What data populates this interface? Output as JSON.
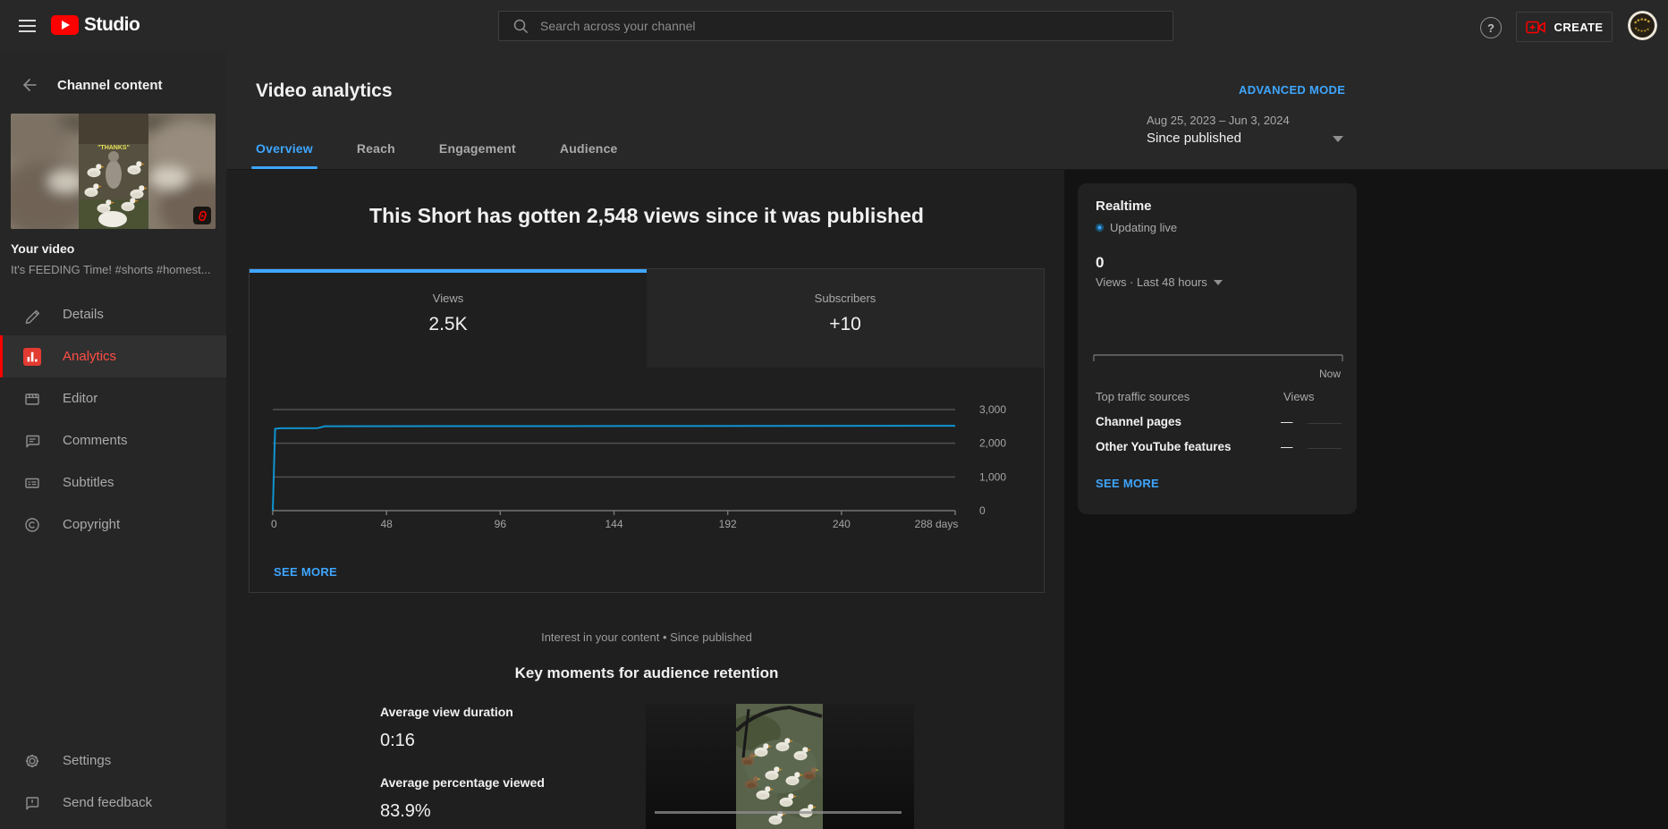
{
  "topbar": {
    "product_name": "Studio",
    "search_placeholder": "Search across your channel",
    "help_glyph": "?",
    "create_label": "CREATE"
  },
  "sidebar": {
    "header": "Channel content",
    "video_label": "Your video",
    "video_title": "It's FEEDING Time! #shorts #homest...",
    "items": [
      {
        "label": "Details",
        "icon": "pencil-icon",
        "active": false
      },
      {
        "label": "Analytics",
        "icon": "bar-chart-icon",
        "active": true
      },
      {
        "label": "Editor",
        "icon": "clapperboard-icon",
        "active": false
      },
      {
        "label": "Comments",
        "icon": "comment-icon",
        "active": false
      },
      {
        "label": "Subtitles",
        "icon": "subtitles-icon",
        "active": false
      },
      {
        "label": "Copyright",
        "icon": "copyright-icon",
        "active": false
      }
    ],
    "footer_items": [
      {
        "label": "Settings",
        "icon": "gear-icon"
      },
      {
        "label": "Send feedback",
        "icon": "feedback-icon"
      }
    ]
  },
  "header": {
    "title": "Video analytics",
    "tabs": [
      {
        "label": "Overview",
        "active": true
      },
      {
        "label": "Reach",
        "active": false
      },
      {
        "label": "Engagement",
        "active": false
      },
      {
        "label": "Audience",
        "active": false
      }
    ],
    "advanced_mode": "ADVANCED MODE",
    "date_range": "Aug 25, 2023 – Jun 3, 2024",
    "date_mode": "Since published"
  },
  "overview": {
    "headline": "This Short has gotten 2,548 views since it was published",
    "metric_tabs": [
      {
        "label": "Views",
        "value": "2.5K",
        "active": true
      },
      {
        "label": "Subscribers",
        "value": "+10",
        "active": false
      }
    ],
    "see_more": "SEE MORE"
  },
  "chart_data": [
    {
      "id": "views-over-time",
      "type": "line",
      "title": "Views since published",
      "xlabel": "days",
      "x_range": [
        0,
        288
      ],
      "x_ticks": [
        "0",
        "48",
        "96",
        "144",
        "192",
        "240",
        "288 days"
      ],
      "ylim": [
        0,
        3000
      ],
      "y_ticks": [
        "0",
        "1,000",
        "2,000",
        "3,000"
      ],
      "grid": true,
      "legend": "none",
      "line_color": "#0f94cf",
      "grid_color": "#505050",
      "axis_color": "#757575",
      "series": [
        {
          "name": "Views",
          "points": [
            [
              0,
              0
            ],
            [
              1,
              2430
            ],
            [
              3,
              2445
            ],
            [
              19,
              2450
            ],
            [
              22,
              2505
            ],
            [
              150,
              2512
            ],
            [
              288,
              2520
            ]
          ]
        }
      ],
      "summary": "Cumulative views jump to ~2.5K within the first days after publishing, then stay flat through 288 days (total 2,548)."
    },
    {
      "id": "realtime-views-last-48h",
      "type": "line",
      "title": "Realtime views, last 48 hours",
      "x_ticks": [
        "Now"
      ],
      "ylim": [
        0,
        1
      ],
      "series": [
        {
          "name": "Views",
          "points": [
            [
              0,
              0
            ],
            [
              48,
              0
            ]
          ]
        }
      ],
      "summary": "Flat at zero for the last 48 hours."
    }
  ],
  "retention": {
    "subtitle": "Interest in your content • Since published",
    "title": "Key moments for audience retention",
    "stats": [
      {
        "label": "Average view duration",
        "value": "0:16"
      },
      {
        "label": "Average percentage viewed",
        "value": "83.9%"
      }
    ]
  },
  "realtime": {
    "title": "Realtime",
    "status": "Updating live",
    "count": "0",
    "count_label": "Views · Last 48 hours",
    "now_label": "Now",
    "table": {
      "col1": "Top traffic sources",
      "col2": "Views",
      "rows": [
        {
          "source": "Channel pages",
          "views": "—"
        },
        {
          "source": "Other YouTube features",
          "views": "—"
        }
      ]
    },
    "see_more": "SEE MORE"
  },
  "icons": {
    "hamburger-menu-icon": "three horizontal bars",
    "search-icon": "magnifier",
    "help-icon": "question mark in circle",
    "create-icon": "video camera with plus",
    "back-arrow-icon": "left arrow",
    "shorts-badge-icon": "YouTube Shorts logo",
    "chevron-down-icon": "filled down triangle",
    "live-dot-icon": "blue live dot"
  },
  "colors": {
    "accent_blue": "#3ea6ff",
    "brand_red": "#ff0000",
    "analytics_active_red": "#ff4e45",
    "chart_line_blue": "#0f94cf",
    "topbar_bg": "#282828",
    "main_bg": "#1f1f1f",
    "right_bg": "#131313",
    "card_bg": "#212121"
  }
}
